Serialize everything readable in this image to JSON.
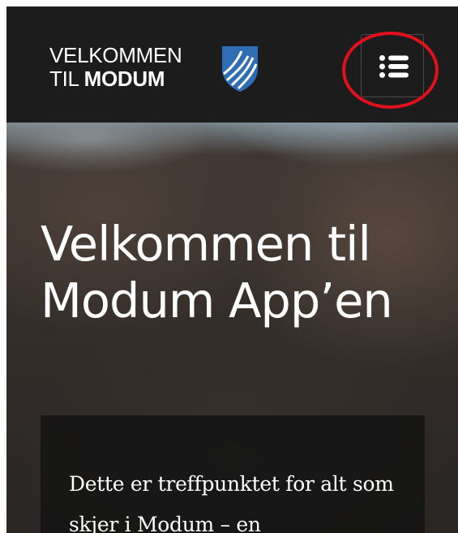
{
  "header": {
    "logo_line1": "VELKOMMEN",
    "logo_line2_prefix": "TIL ",
    "logo_line2_bold": "MODUM",
    "shield_icon": "modum-coat-of-arms-icon",
    "menu_icon": "list-menu-icon"
  },
  "hero": {
    "title_line1": "Velkommen til",
    "title_line2": "Modum App’en"
  },
  "intro": {
    "text": "Dette er treffpunktet for alt som skjer i Modum – en"
  },
  "colors": {
    "header_bg": "#1c1c1c",
    "shield_blue": "#2f6db5",
    "highlight_red": "#e0111b"
  }
}
